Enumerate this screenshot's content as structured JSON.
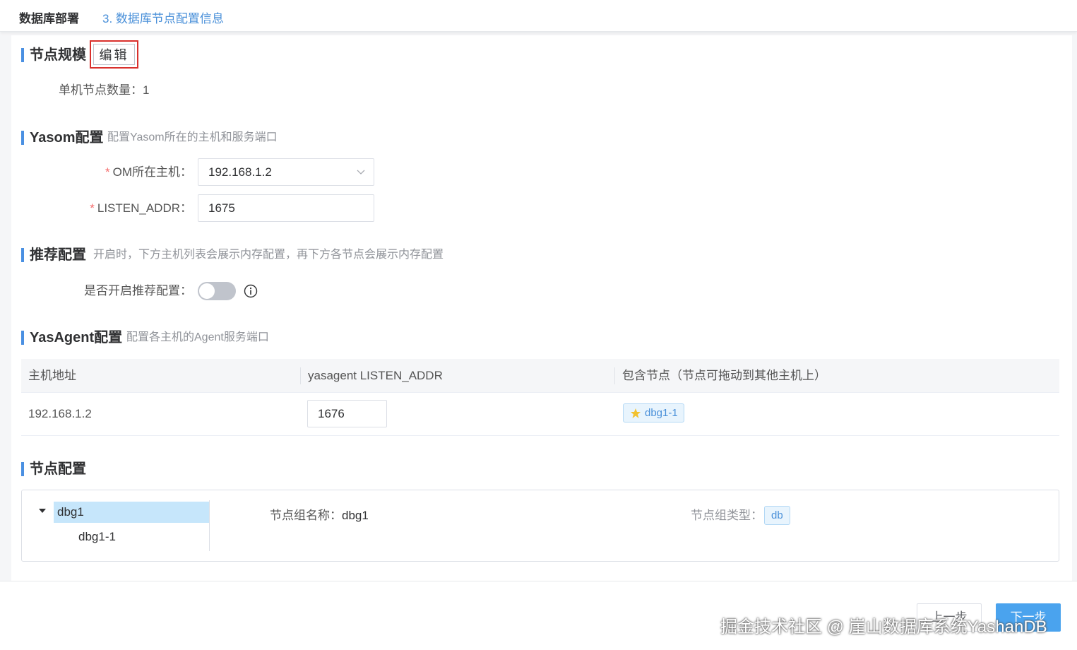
{
  "header": {
    "title": "数据库部署",
    "breadcrumb": "3. 数据库节点配置信息"
  },
  "node_scale": {
    "title": "节点规模",
    "edit_label": "编辑",
    "single_node_count_label": "单机节点数量：",
    "single_node_count": "1"
  },
  "yasom": {
    "title": "Yasom配置",
    "desc": "配置Yasom所在的主机和服务端口",
    "om_host_label": "OM所在主机：",
    "om_host_value": "192.168.1.2",
    "listen_addr_label": "LISTEN_ADDR：",
    "listen_addr_value": "1675",
    "required_mark": "*"
  },
  "recommend": {
    "title": "推荐配置",
    "desc": "开启时，下方主机列表会展示内存配置，再下方各节点会展示内存配置",
    "toggle_label": "是否开启推荐配置：",
    "enabled": false
  },
  "yasagent": {
    "title": "YasAgent配置",
    "desc": "配置各主机的Agent服务端口",
    "columns": [
      "主机地址",
      "yasagent LISTEN_ADDR",
      "包含节点（节点可拖动到其他主机上）"
    ],
    "rows": [
      {
        "host": "192.168.1.2",
        "listen_addr": "1676",
        "node": "dbg1-1"
      }
    ]
  },
  "node_config": {
    "title": "节点配置",
    "tree": {
      "group": "dbg1",
      "child": "dbg1-1"
    },
    "group_name_label": "节点组名称：",
    "group_name": "dbg1",
    "group_type_label": "节点组类型：",
    "group_type": "db"
  },
  "footer": {
    "prev_label": "上一步",
    "next_label": "下一步",
    "watermark": "掘金技术社区 @ 崖山数据库系统YashanDB"
  },
  "colors": {
    "accent": "#4a90e2",
    "required": "#f56c6c",
    "highlight_border": "#d9302c"
  }
}
